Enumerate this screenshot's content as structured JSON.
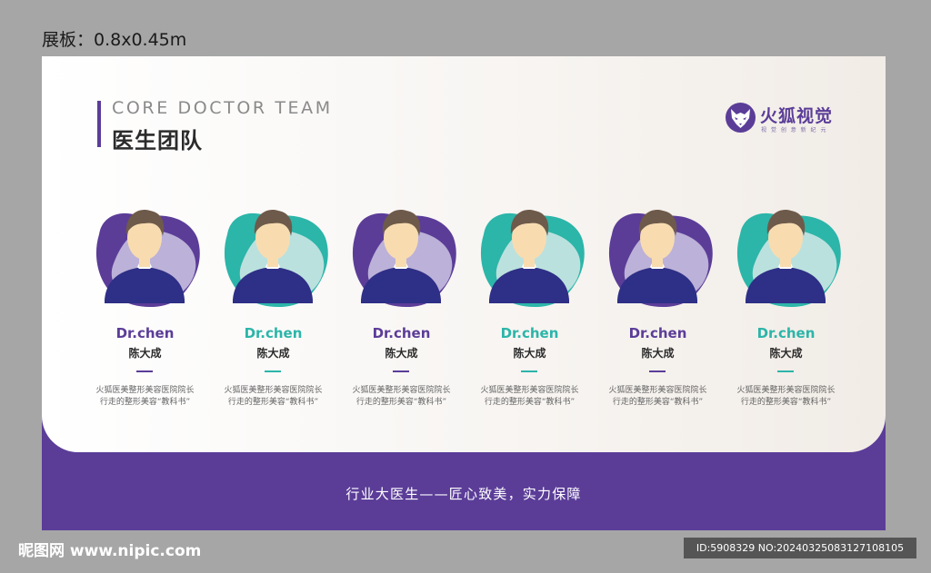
{
  "dimension_label": "展板：0.8x0.45m",
  "header": {
    "title_en": "CORE DOCTOR TEAM",
    "title_cn": "医生团队"
  },
  "logo": {
    "name": "火狐视觉",
    "slogan": "视 觉 创 意 新 纪 元",
    "icon": "fox-logo-icon"
  },
  "colors": {
    "purple": "#5b3d98",
    "purple_light": "#c7bedf",
    "teal": "#2cb5a9",
    "teal_light": "#cbe6e3",
    "suit": "#2e2f86",
    "skin": "#f8dcb0",
    "hair": "#6e5a4a"
  },
  "doctors": [
    {
      "name": "Dr.chen",
      "name_cn": "陈大成",
      "desc": "火狐医美整形美容医院院长\n行走的整形美容“教科书”",
      "theme": "purple"
    },
    {
      "name": "Dr.chen",
      "name_cn": "陈大成",
      "desc": "火狐医美整形美容医院院长\n行走的整形美容“教科书”",
      "theme": "teal"
    },
    {
      "name": "Dr.chen",
      "name_cn": "陈大成",
      "desc": "火狐医美整形美容医院院长\n行走的整形美容“教科书”",
      "theme": "purple"
    },
    {
      "name": "Dr.chen",
      "name_cn": "陈大成",
      "desc": "火狐医美整形美容医院院长\n行走的整形美容“教科书”",
      "theme": "teal"
    },
    {
      "name": "Dr.chen",
      "name_cn": "陈大成",
      "desc": "火狐医美整形美容医院院长\n行走的整形美容“教科书”",
      "theme": "purple"
    },
    {
      "name": "Dr.chen",
      "name_cn": "陈大成",
      "desc": "火狐医美整形美容医院院长\n行走的整形美容“教科书”",
      "theme": "teal"
    }
  ],
  "footer": {
    "slogan": "行业大医生——匠心致美，实力保障"
  },
  "watermark": {
    "site": "昵图网 www.nipic.com",
    "id": "ID:5908329 NO:20240325083127108105"
  }
}
